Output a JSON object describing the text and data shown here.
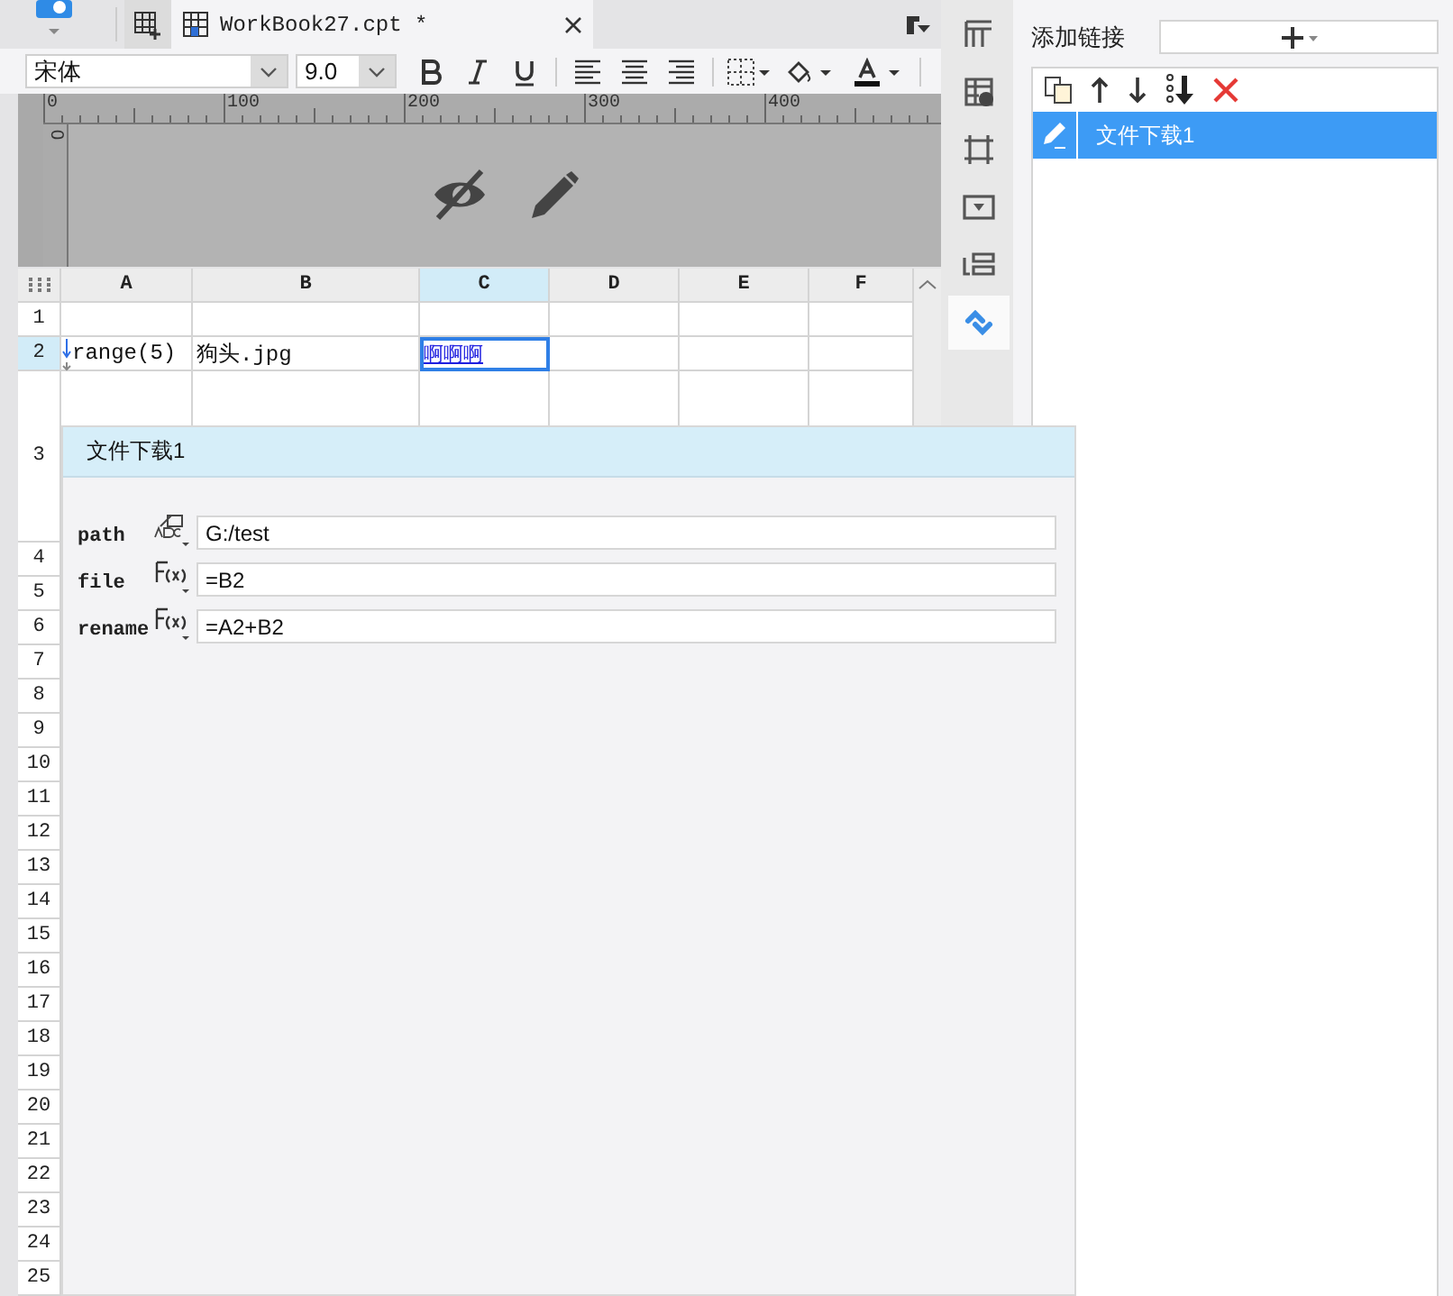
{
  "tabs": [
    {
      "label": "WorkBook27.cpt *",
      "selected": true
    }
  ],
  "format_toolbar": {
    "font": "宋体",
    "size": "9.0"
  },
  "ruler": {
    "marks": [
      "0",
      "100",
      "200",
      "300",
      "400"
    ],
    "vertical_mark": "0"
  },
  "sheet": {
    "columns": [
      {
        "label": "A",
        "selected": false
      },
      {
        "label": "B",
        "selected": false
      },
      {
        "label": "C",
        "selected": true
      },
      {
        "label": "D",
        "selected": false
      },
      {
        "label": "E",
        "selected": false
      },
      {
        "label": "F",
        "selected": false
      }
    ],
    "rows": [
      {
        "label": "1",
        "selected": false,
        "cells": [
          {
            "selected": false
          },
          {
            "selected": false
          },
          {
            "selected": false
          },
          {
            "selected": false
          },
          {
            "selected": false
          },
          {
            "selected": false
          }
        ]
      },
      {
        "label": "2",
        "selected": true,
        "cells": [
          {
            "text": "range(5)",
            "kind": "expand",
            "selected": false
          },
          {
            "text": "狗头.jpg",
            "kind": "plain",
            "selected": false
          },
          {
            "text": "啊啊啊",
            "kind": "link",
            "selected": true
          },
          {
            "selected": false
          },
          {
            "selected": false
          },
          {
            "selected": false
          }
        ]
      },
      {
        "label": "3",
        "selected": false,
        "cells": [
          {
            "selected": false
          },
          {
            "selected": false
          },
          {
            "selected": false
          },
          {
            "selected": false
          },
          {
            "selected": false
          },
          {
            "selected": false
          }
        ]
      },
      {
        "label": "4",
        "selected": false
      },
      {
        "label": "5",
        "selected": false
      },
      {
        "label": "6",
        "selected": false
      },
      {
        "label": "7",
        "selected": false
      },
      {
        "label": "8",
        "selected": false
      },
      {
        "label": "9",
        "selected": false
      },
      {
        "label": "10",
        "selected": false
      },
      {
        "label": "11",
        "selected": false
      },
      {
        "label": "12",
        "selected": false
      },
      {
        "label": "13",
        "selected": false
      },
      {
        "label": "14",
        "selected": false
      },
      {
        "label": "15",
        "selected": false
      },
      {
        "label": "16",
        "selected": false
      },
      {
        "label": "17",
        "selected": false
      },
      {
        "label": "18",
        "selected": false
      },
      {
        "label": "19",
        "selected": false
      },
      {
        "label": "20",
        "selected": false
      },
      {
        "label": "21",
        "selected": false
      },
      {
        "label": "22",
        "selected": false
      },
      {
        "label": "23",
        "selected": false
      },
      {
        "label": "24",
        "selected": false
      },
      {
        "label": "25",
        "selected": false
      }
    ]
  },
  "popup": {
    "title": "文件下载1",
    "params": [
      {
        "name": "path",
        "kind": "string",
        "value": "G:/test"
      },
      {
        "name": "file",
        "kind": "formula",
        "value": "=B2"
      },
      {
        "name": "rename",
        "kind": "formula",
        "value": "=A2+B2"
      }
    ]
  },
  "side_strip": [
    {
      "selected": false
    },
    {
      "selected": false
    },
    {
      "selected": false
    },
    {
      "selected": false
    },
    {
      "selected": false
    },
    {
      "selected": true
    }
  ],
  "hyperlink_panel": {
    "label": "添加链接",
    "links": [
      {
        "label": "文件下载1",
        "selected": true
      }
    ]
  }
}
